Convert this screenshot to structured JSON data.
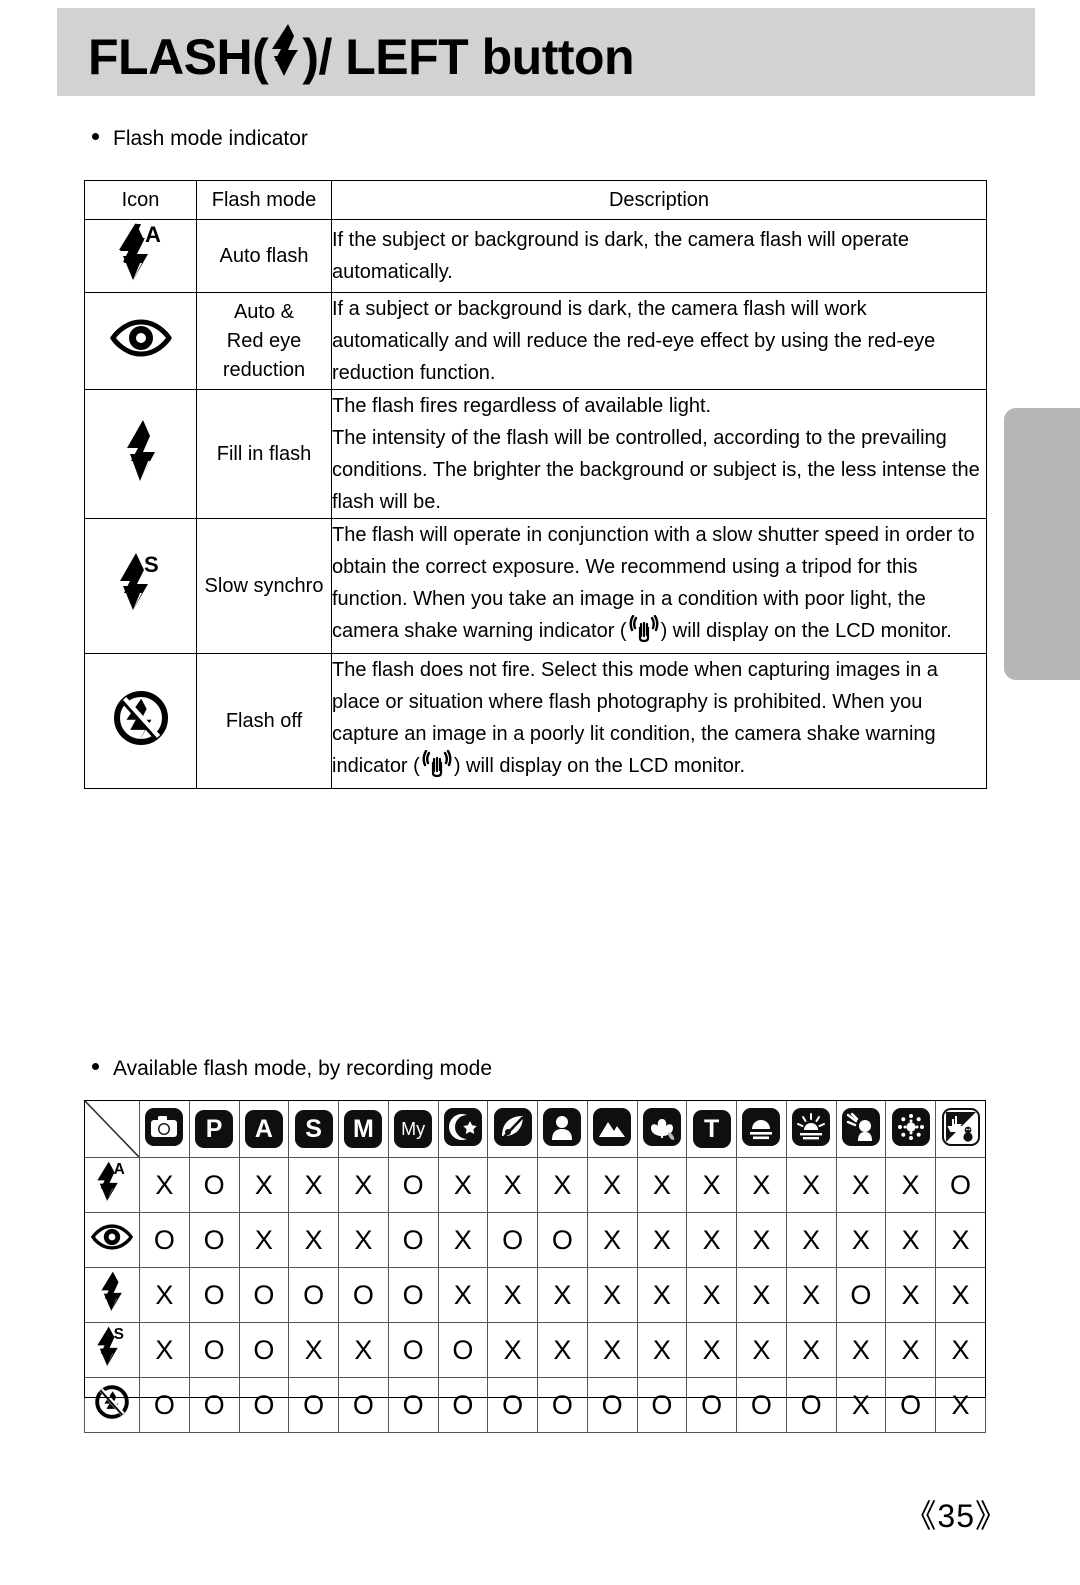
{
  "header": {
    "title_prefix": "FLASH(",
    "title_icon": "flash-bolt-icon",
    "title_suffix": ")/ LEFT button"
  },
  "section1": {
    "bullet_label": "Flash mode indicator",
    "columns": [
      "Icon",
      "Flash mode",
      "Description"
    ],
    "rows": [
      {
        "icon": "flash-auto-icon",
        "mode": "Auto flash",
        "description": "If the subject or background is dark, the camera flash will operate automatically."
      },
      {
        "icon": "red-eye-icon",
        "mode": "Auto &\nRed eye\nreduction",
        "description": "If a subject or background is dark, the camera flash will work automatically and will reduce the red-eye effect by using the red-eye reduction function."
      },
      {
        "icon": "flash-fill-icon",
        "mode": "Fill in flash",
        "description": "The flash fires regardless of available light.\nThe intensity of the flash will be controlled, according to the prevailing conditions. The brighter the background or subject is, the less intense the flash will be."
      },
      {
        "icon": "flash-slow-sync-icon",
        "mode": "Slow synchro",
        "description_part1": "The flash will operate in conjunction with a slow shutter speed in order to obtain the correct exposure. We recommend using a tripod for this function. When you take an image in a condition with poor light, the camera shake warning indicator (",
        "description_part2": ") will display on the LCD monitor.",
        "inline_icon": "camera-shake-warning-icon"
      },
      {
        "icon": "flash-off-icon",
        "mode": "Flash off",
        "description_part1": "The flash does not fire. Select this mode when capturing images in a place or situation where flash photography is prohibited. When you capture an image in a poorly lit condition, the camera shake warning indicator (",
        "description_part2": ") will display on the LCD monitor.",
        "inline_icon": "camera-shake-warning-icon"
      }
    ]
  },
  "section2": {
    "bullet_label": "Available flash mode, by recording mode",
    "mode_columns": [
      {
        "name": "auto-mode-icon",
        "label": ""
      },
      {
        "name": "program-mode-icon",
        "label": "P"
      },
      {
        "name": "aperture-priority-mode-icon",
        "label": "A"
      },
      {
        "name": "shutter-priority-mode-icon",
        "label": "S"
      },
      {
        "name": "manual-mode-icon",
        "label": "M"
      },
      {
        "name": "my-set-mode-icon",
        "label": "My"
      },
      {
        "name": "night-scene-mode-icon",
        "label": ""
      },
      {
        "name": "scene-mode-icon",
        "label": ""
      },
      {
        "name": "portrait-mode-icon",
        "label": ""
      },
      {
        "name": "landscape-mode-icon",
        "label": ""
      },
      {
        "name": "close-up-mode-icon",
        "label": ""
      },
      {
        "name": "text-mode-icon",
        "label": "T"
      },
      {
        "name": "sunset-mode-icon",
        "label": ""
      },
      {
        "name": "dawn-mode-icon",
        "label": ""
      },
      {
        "name": "backlight-mode-icon",
        "label": ""
      },
      {
        "name": "fireworks-mode-icon",
        "label": ""
      },
      {
        "name": "beach-snow-mode-icon",
        "label": ""
      }
    ],
    "flash_rows": [
      {
        "icon": "flash-auto-icon",
        "values": [
          "X",
          "O",
          "X",
          "X",
          "X",
          "O",
          "X",
          "X",
          "X",
          "X",
          "X",
          "X",
          "X",
          "X",
          "X",
          "X",
          "O"
        ]
      },
      {
        "icon": "red-eye-icon",
        "values": [
          "O",
          "O",
          "X",
          "X",
          "X",
          "O",
          "X",
          "O",
          "O",
          "X",
          "X",
          "X",
          "X",
          "X",
          "X",
          "X",
          "X"
        ]
      },
      {
        "icon": "flash-fill-icon",
        "values": [
          "X",
          "O",
          "O",
          "O",
          "O",
          "O",
          "X",
          "X",
          "X",
          "X",
          "X",
          "X",
          "X",
          "X",
          "O",
          "X",
          "X"
        ]
      },
      {
        "icon": "flash-slow-sync-icon",
        "values": [
          "X",
          "O",
          "O",
          "X",
          "X",
          "O",
          "O",
          "X",
          "X",
          "X",
          "X",
          "X",
          "X",
          "X",
          "X",
          "X",
          "X"
        ]
      },
      {
        "icon": "flash-off-icon",
        "values": [
          "O",
          "O",
          "O",
          "O",
          "O",
          "O",
          "O",
          "O",
          "O",
          "O",
          "O",
          "O",
          "O",
          "O",
          "X",
          "O",
          "X"
        ]
      }
    ]
  },
  "footer": {
    "page_number": "《35》"
  }
}
